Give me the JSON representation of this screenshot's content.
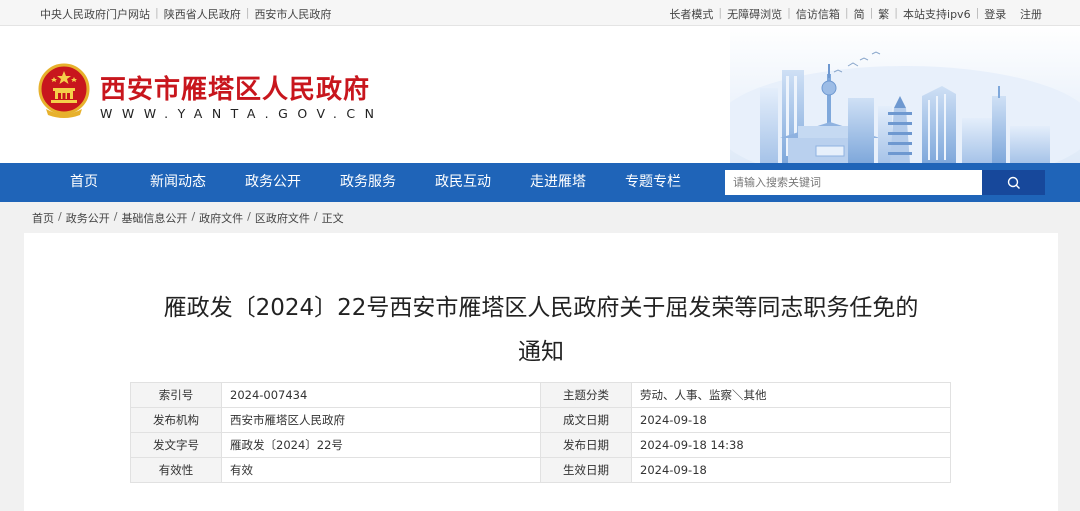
{
  "topbar": {
    "left_links": [
      "中央人民政府门户网站",
      "陕西省人民政府",
      "西安市人民政府"
    ],
    "right_links": [
      "长者模式",
      "无障碍浏览",
      "信访信箱",
      "简",
      "繁",
      "本站支持ipv6",
      "登录",
      "注册"
    ]
  },
  "header": {
    "site_title": "西安市雁塔区人民政府",
    "site_domain": "WWW.YANTA.GOV.CN"
  },
  "nav": {
    "items": [
      "首页",
      "新闻动态",
      "政务公开",
      "政务服务",
      "政民互动",
      "走进雁塔",
      "专题专栏"
    ],
    "search_placeholder": "请输入搜索关键词"
  },
  "breadcrumb": [
    "首页",
    "政务公开",
    "基础信息公开",
    "政府文件",
    "区政府文件",
    "正文"
  ],
  "document": {
    "title_line1": "雁政发〔2024〕22号西安市雁塔区人民政府关于屈发荣等同志职务任免的",
    "title_line2": "通知",
    "meta_rows": [
      {
        "k1": "索引号",
        "v1": "2024-007434",
        "k2": "主题分类",
        "v2": "劳动、人事、监察＼其他"
      },
      {
        "k1": "发布机构",
        "v1": "西安市雁塔区人民政府",
        "k2": "成文日期",
        "v2": "2024-09-18"
      },
      {
        "k1": "发文字号",
        "v1": "雁政发〔2024〕22号",
        "k2": "发布日期",
        "v2": "2024-09-18 14:38"
      },
      {
        "k1": "有效性",
        "v1": "有效",
        "k2": "生效日期",
        "v2": "2024-09-18"
      }
    ]
  },
  "colors": {
    "nav_bg": "#1f64b8",
    "search_btn": "#17489b",
    "title_red": "#c8161d"
  },
  "icons": {
    "emblem": "national-emblem-icon",
    "search": "search-icon"
  }
}
